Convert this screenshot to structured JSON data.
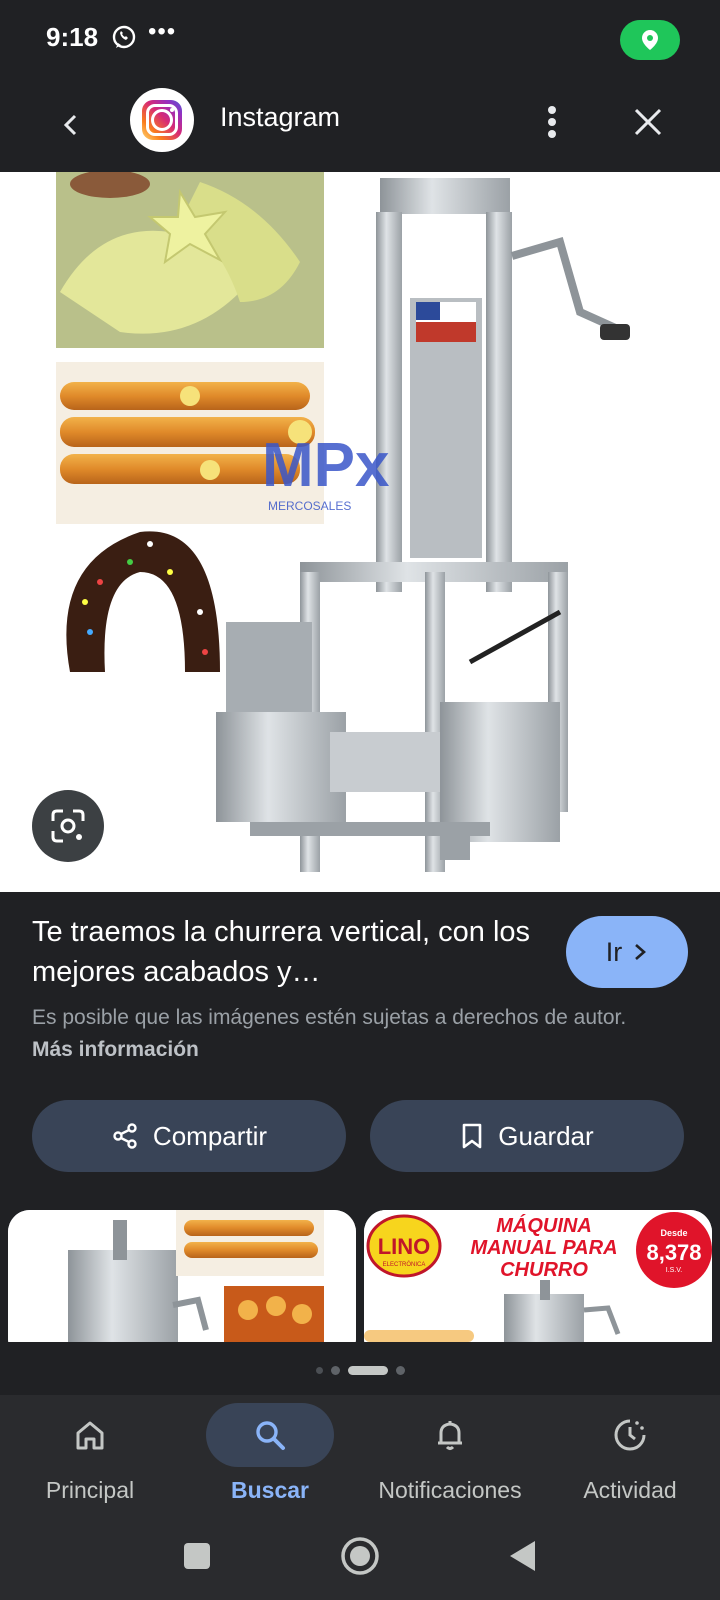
{
  "status_bar": {
    "time": "9:18",
    "more": "•••"
  },
  "app_bar": {
    "title": "Instagram"
  },
  "result": {
    "headline": "Te traemos la churrera vertical, con los mejores acabados y…",
    "go_label": "Ir",
    "copyright_text": "Es posible que las imágenes estén sujetas a derechos de autor.",
    "more_info_label": "Más información"
  },
  "main_image": {
    "logo_text": "MPx",
    "logo_subtext": "MERCOSALES"
  },
  "actions": {
    "share_label": "Compartir",
    "save_label": "Guardar"
  },
  "related": [
    {
      "image": "churro-machine-thumbnail"
    },
    {
      "image": "manual-churro-machine-ad",
      "brand": "LINO",
      "brand_sub": "ELECTRÓNICA",
      "heading_line1": "MÁQUINA",
      "heading_line2": "MANUAL PARA",
      "heading_line3": "CHURRO",
      "price_prefix": "Desde",
      "price": "8,378",
      "price_suffix": "I.S.V."
    }
  ],
  "bottom_nav": [
    {
      "label": "Principal",
      "icon": "home-icon",
      "active": false
    },
    {
      "label": "Buscar",
      "icon": "search-icon",
      "active": true
    },
    {
      "label": "Notificaciones",
      "icon": "bell-icon",
      "active": false
    },
    {
      "label": "Actividad",
      "icon": "activity-icon",
      "active": false
    }
  ],
  "colors": {
    "background": "#202124",
    "accent": "#8ab4f8",
    "button_bg": "#394457",
    "location_green": "#1fc65a"
  }
}
